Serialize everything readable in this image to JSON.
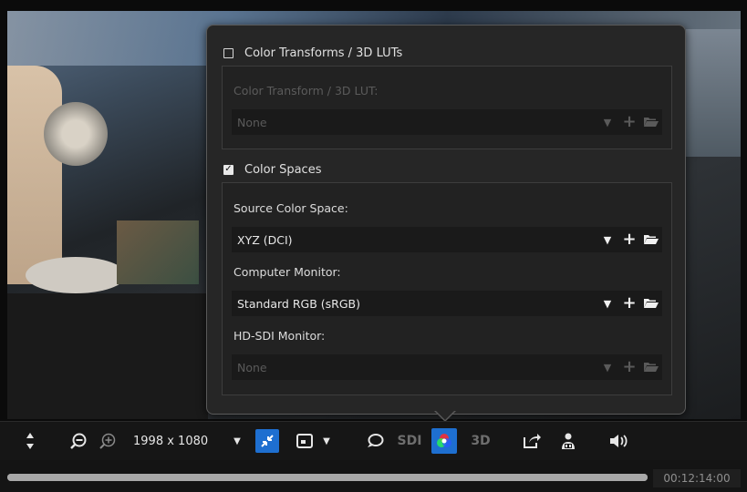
{
  "color_transforms": {
    "label": "Color Transforms / 3D LUTs",
    "checked": false,
    "field_label": "Color Transform / 3D LUT:",
    "value": "None"
  },
  "color_spaces": {
    "label": "Color Spaces",
    "checked": true,
    "check_glyph": "✓",
    "source_label": "Source Color Space:",
    "source_value": "XYZ (DCI)",
    "monitor_label": "Computer Monitor:",
    "monitor_value": "Standard RGB (sRGB)",
    "sdi_label": "HD-SDI Monitor:",
    "sdi_value": "None"
  },
  "toolbar": {
    "resolution": "1998 x 1080",
    "sdi_label": "SDI",
    "three_d_label": "3D",
    "active_color": "#1e6fd0"
  },
  "playback": {
    "progress": 1.0,
    "timecode": "00:12:14:00"
  },
  "icons": [
    "updown-arrows-icon",
    "zoom-out-icon",
    "zoom-in-icon",
    "dropdown-arrow-icon",
    "fit-to-window-icon",
    "aspect-frame-icon",
    "comment-icon",
    "color-wheel-icon",
    "share-icon",
    "users-icon",
    "volume-icon",
    "add-icon",
    "folder-open-icon"
  ]
}
